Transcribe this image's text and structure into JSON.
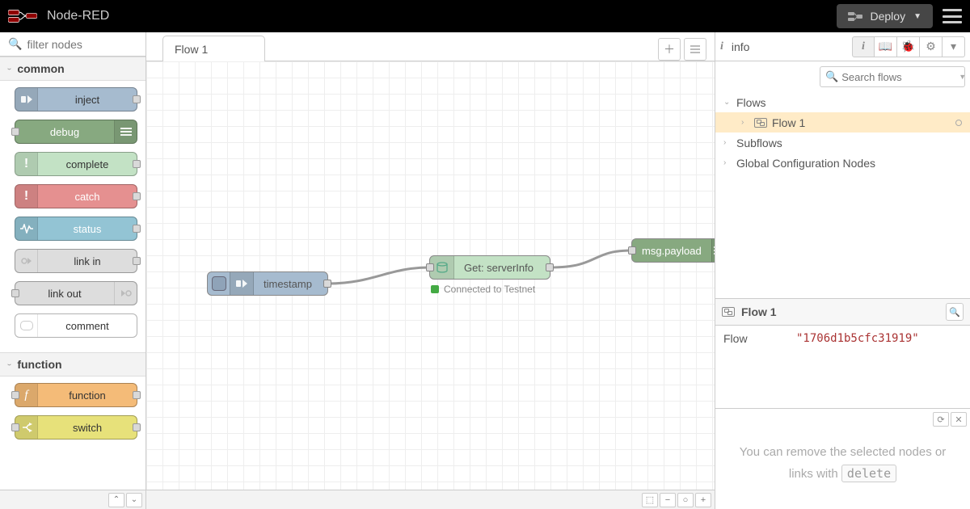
{
  "header": {
    "brand": "Node-RED",
    "deploy": "Deploy"
  },
  "palette": {
    "filter_placeholder": "filter nodes",
    "categories": [
      {
        "name": "common",
        "nodes": [
          "inject",
          "debug",
          "complete",
          "catch",
          "status",
          "link in",
          "link out",
          "comment"
        ]
      },
      {
        "name": "function",
        "nodes": [
          "function",
          "switch"
        ]
      }
    ]
  },
  "workspace": {
    "tab": "Flow 1",
    "nodes": {
      "inject": "timestamp",
      "mid": "Get: serverInfo",
      "mid_status": "Connected to Testnet",
      "out": "msg.payload"
    }
  },
  "sidebar": {
    "title": "info",
    "search_placeholder": "Search flows",
    "tree": {
      "flows": "Flows",
      "flow1": "Flow 1",
      "subflows": "Subflows",
      "global": "Global Configuration Nodes"
    },
    "info": {
      "head": "Flow 1",
      "key": "Flow",
      "val": "\"1706d1b5cfc31919\""
    },
    "help_pre": "You can remove the selected nodes or links with ",
    "help_code": "delete"
  }
}
